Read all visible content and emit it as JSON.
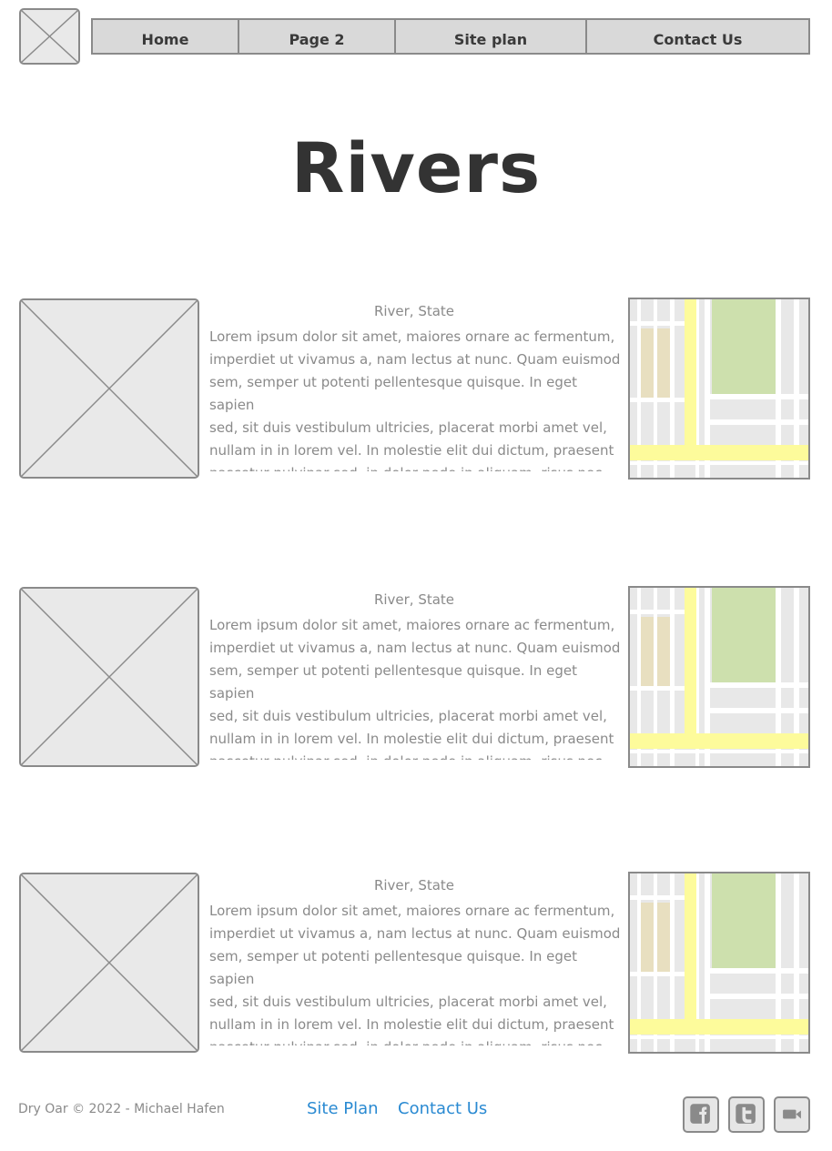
{
  "header": {
    "nav": [
      {
        "label": "Home"
      },
      {
        "label": "Page 2"
      },
      {
        "label": "Site plan"
      },
      {
        "label": "Contact Us"
      }
    ]
  },
  "page": {
    "title": "Rivers"
  },
  "rivers": [
    {
      "caption": "River, State",
      "text": "Lorem ipsum dolor sit amet, maiores ornare ac fermentum,\nimperdiet ut vivamus a, nam lectus at nunc. Quam euismod\nsem, semper ut potenti pellentesque quisque. In eget sapien\nsed, sit duis vestibulum ultricies, placerat morbi amet vel,\nnullam in in lorem vel. In molestie elit dui dictum, praesent\nnascetur pulvinar sed, in dolor pede in aliquam, risus nec error\nquis pharetra. Eros metus quam augue suspendisse, metus"
    },
    {
      "caption": "River, State",
      "text": "Lorem ipsum dolor sit amet, maiores ornare ac fermentum,\nimperdiet ut vivamus a, nam lectus at nunc. Quam euismod\nsem, semper ut potenti pellentesque quisque. In eget sapien\nsed, sit duis vestibulum ultricies, placerat morbi amet vel,\nnullam in in lorem vel. In molestie elit dui dictum, praesent\nnascetur pulvinar sed, in dolor pede in aliquam, risus nec error\nquis pharetra. Eros metus quam augue suspendisse, metus"
    },
    {
      "caption": "River, State",
      "text": "Lorem ipsum dolor sit amet, maiores ornare ac fermentum,\nimperdiet ut vivamus a, nam lectus at nunc. Quam euismod\nsem, semper ut potenti pellentesque quisque. In eget sapien\nsed, sit duis vestibulum ultricies, placerat morbi amet vel,\nnullam in in lorem vel. In molestie elit dui dictum, praesent\nnascetur pulvinar sed, in dolor pede in aliquam, risus nec error\nquis pharetra. Eros metus quam augue suspendisse, metus"
    }
  ],
  "footer": {
    "copyright": "Dry Oar © 2022 - Michael Hafen",
    "links": [
      {
        "label": "Site Plan"
      },
      {
        "label": "Contact Us"
      }
    ],
    "social_icons": [
      "facebook-icon",
      "twitter-icon",
      "video-camera-icon"
    ]
  },
  "colors": {
    "link": "#2a8ad2",
    "placeholder_fill": "#e9e9e9",
    "border": "#8a8a8a",
    "map_park": "#cde0ad",
    "map_road": "#fdfb9b",
    "map_building": "#e8dfc0"
  }
}
